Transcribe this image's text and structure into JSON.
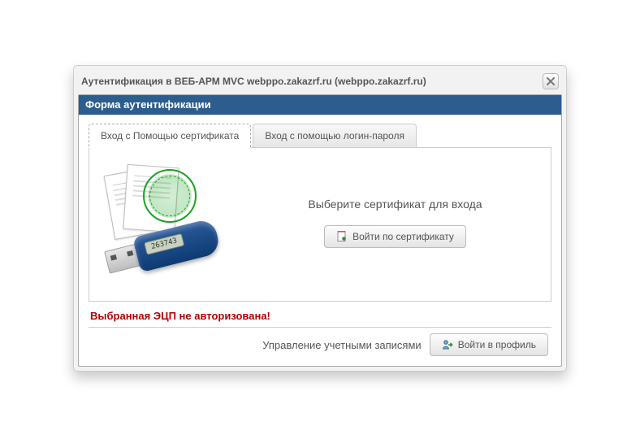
{
  "dialog": {
    "title": "Аутентификация в ВЕБ-АРМ MVC webppo.zakazrf.ru (webppo.zakazrf.ru)"
  },
  "section": {
    "header": "Форма аутентификации"
  },
  "tabs": {
    "cert": "Вход с Помощью сертификата",
    "login": "Вход с помощью логин-пароля"
  },
  "cert_pane": {
    "prompt": "Выберите сертификат для входа",
    "button": "Войти по сертификату",
    "token_display": "263743"
  },
  "error": "Выбранная ЭЦП не авторизована!",
  "footer": {
    "label": "Управление учетными записями",
    "button": "Войти в профиль"
  }
}
